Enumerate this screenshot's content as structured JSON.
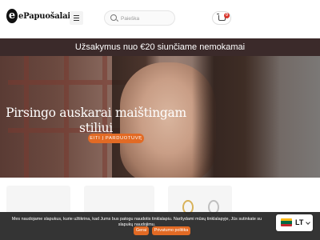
{
  "header": {
    "logo_mark": "e",
    "logo_text": "ePapuošalai",
    "search_placeholder": "Paieška",
    "cart_count": "0"
  },
  "promo": {
    "text": "Užsakymus nuo €20 siunčiame nemokamai"
  },
  "hero": {
    "title": "Pirsingo auskarai maištingam stiliui",
    "button": "EITI Į PARDUOTUVĘ"
  },
  "cookie": {
    "text": "Mes naudojame slapukus, kurie užtikrina, kad Jums bus patogu naudotis tinklalapiu. Naršydami mūsų tinklalapyje, Jūs sutinkate su slapukų naudojimu.",
    "accept_label": "Gerai",
    "policy_label": "Privatumo politika"
  },
  "language": {
    "code": "LT",
    "flag_colors": [
      "#FDB913",
      "#006A44",
      "#C1272D"
    ]
  },
  "colors": {
    "accent": "#e26a24",
    "promo_bg": "#3b2a2a",
    "badge": "#d9352b"
  },
  "icons": [
    "menu-icon",
    "search-icon",
    "cart-icon",
    "chevron-down-icon"
  ]
}
